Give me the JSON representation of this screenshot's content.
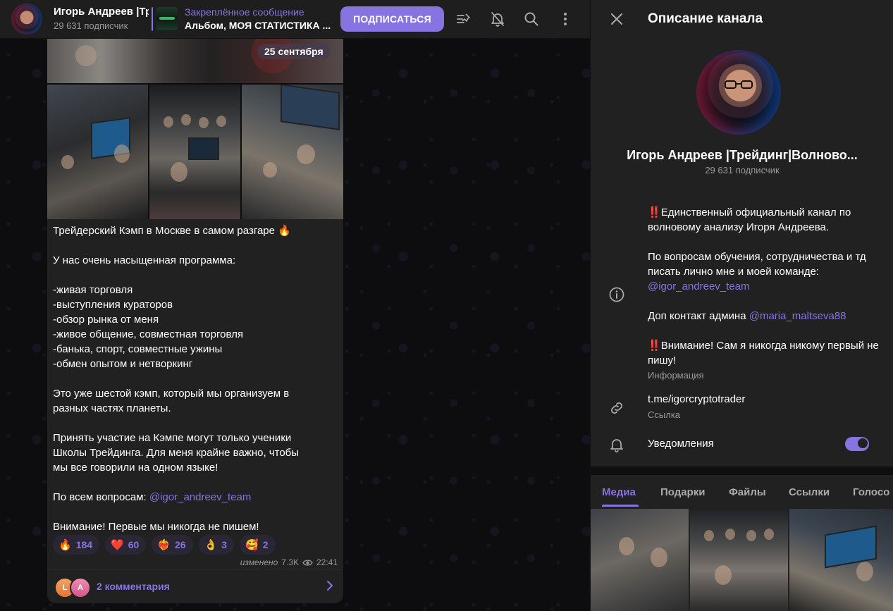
{
  "header": {
    "channel_title": "Игорь Андреев |Трейдинг|Волновой анализ",
    "subscribers": "29 631 подписчик",
    "pinned_label": "Закреплённое сообщение",
    "pinned_text": "Альбом, МОЯ СТАТИСТИКА ...",
    "subscribe_label": "ПОДПИСАТЬСЯ",
    "icons": [
      "pinned-list-icon",
      "mute-bell-icon",
      "search-icon",
      "more-vertical-icon"
    ]
  },
  "chat": {
    "date_badge": "25 сентября",
    "message": {
      "lines": [
        "Трейдерский Кэмп в Москве в самом разгаре 🔥",
        "",
        "У нас очень насыщенная программа:",
        "",
        "-живая торговля",
        "-выступления кураторов",
        "-обзор рынка от меня",
        "-живое общение, совместная торговля",
        "-банька, спорт, совместные ужины",
        "-обмен опытом и нетворкинг",
        "",
        "Это уже шестой кэмп, который мы организуем в",
        "разных частях планеты.",
        "",
        "Принять участие на Кэмпе могут только ученики",
        "Школы Трейдинга. Для меня крайне важно, чтобы",
        "мы все говорили на одном языке!",
        ""
      ],
      "contact_prefix": "По всем вопросам: ",
      "contact_link": "@igor_andreev_team",
      "final_line": "Внимание! Первые мы никогда не пишем!"
    },
    "reactions": [
      {
        "emoji": "🔥",
        "count": "184"
      },
      {
        "emoji": "❤️",
        "count": "60"
      },
      {
        "emoji": "❤️‍🔥",
        "count": "26"
      },
      {
        "emoji": "👌",
        "count": "3"
      },
      {
        "emoji": "🥰",
        "count": "2"
      }
    ],
    "edited_label": "изменено",
    "views": "7.3K",
    "time": "22:41",
    "comments": {
      "avatars": [
        "L",
        "A"
      ],
      "label": "2 комментария"
    }
  },
  "panel": {
    "title": "Описание канала",
    "name": "Игорь Андреев |Трейдинг|Волново...",
    "subscribers": "29 631 подписчик",
    "description": {
      "p1": "Единственный официальный канал по волновому анализу Игоря Андреева.",
      "p2": "По вопросам обучения, сотрудничества и тд писать лично мне и моей команде:",
      "p2_link": "@igor_andreev_team",
      "p3_prefix": "Доп контакт админа ",
      "p3_link": "@maria_maltseva88",
      "p4": "Внимание! Сам я никогда никому первый не пишу!",
      "bang": "‼️"
    },
    "info_label": "Информация",
    "link": "t.me/igorcryptotrader",
    "link_label": "Ссылка",
    "notifications_label": "Уведомления",
    "notifications_on": true,
    "tabs": [
      "Медиа",
      "Подарки",
      "Файлы",
      "Ссылки",
      "Голосо"
    ],
    "active_tab": "Медиа"
  },
  "colors": {
    "accent": "#8774e1",
    "panel_bg": "#212121",
    "header_bg": "#1e1e1f",
    "muted_text": "#9a9a9a",
    "reaction_bg": "#2b2634"
  }
}
